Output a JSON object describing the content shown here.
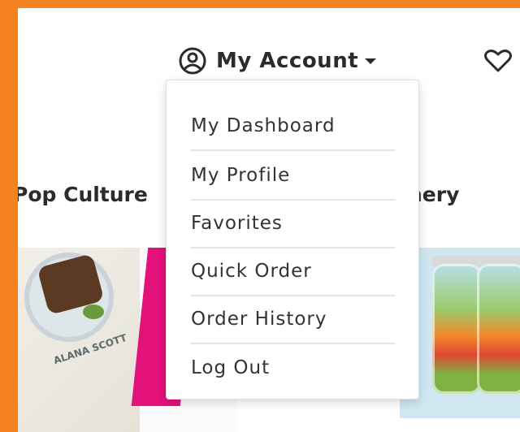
{
  "header": {
    "account_label": "My Account",
    "icons": {
      "account": "user-circle-icon",
      "caret": "caret-down-icon",
      "favorites": "heart-icon"
    }
  },
  "categories": {
    "left": "Pop Culture",
    "right": "nery"
  },
  "account_menu": {
    "items": [
      {
        "label": "My Dashboard"
      },
      {
        "label": "My Profile"
      },
      {
        "label": "Favorites"
      },
      {
        "label": "Quick Order"
      },
      {
        "label": "Order History"
      },
      {
        "label": "Log Out"
      }
    ]
  },
  "hero_images": {
    "left_book_author": "ALANA SCOTT"
  },
  "colors": {
    "frame": "#f58220",
    "accent_magenta": "#e3117a",
    "text": "#2b2b2b"
  }
}
